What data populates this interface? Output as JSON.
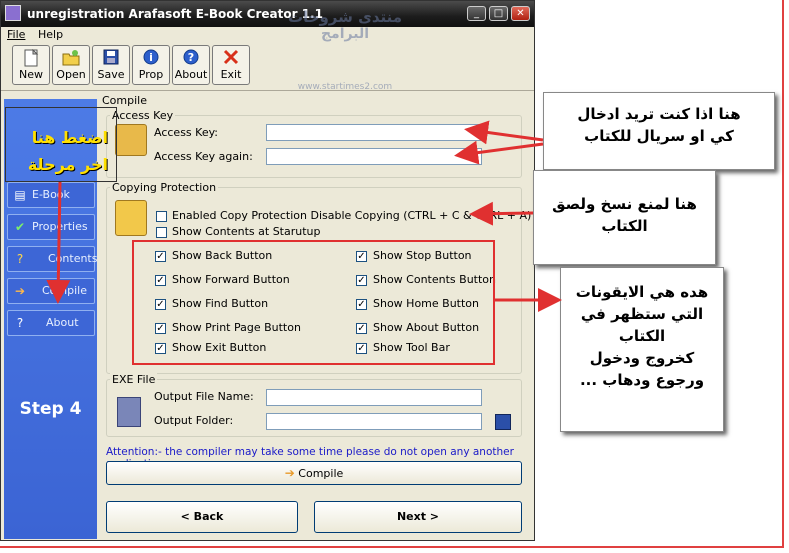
{
  "window": {
    "title": "unregistration Arafasoft E-Book Creator 1.1",
    "buttons": {
      "minimize": "_",
      "maximize": "□",
      "close": "✕"
    }
  },
  "menu": [
    "File",
    "Help"
  ],
  "toolbar": [
    {
      "label": "New",
      "icon": "new-document-icon"
    },
    {
      "label": "Open",
      "icon": "open-folder-icon"
    },
    {
      "label": "Save",
      "icon": "save-icon"
    },
    {
      "label": "Prop",
      "icon": "info-icon"
    },
    {
      "label": "About",
      "icon": "help-icon"
    },
    {
      "label": "Exit",
      "icon": "exit-icon"
    }
  ],
  "watermark": {
    "line1": "منتدى شروحات",
    "line2": "البرامج",
    "url": "www.startimes2.com"
  },
  "sidebar": {
    "items": [
      {
        "label": "E-Book Files",
        "icon": "files-icon"
      },
      {
        "label": "Properties",
        "icon": "check-icon"
      },
      {
        "label": "Contents",
        "icon": "question-icon"
      },
      {
        "label": "Compile",
        "icon": "arrow-right-icon"
      },
      {
        "label": "About",
        "icon": "help-icon"
      }
    ],
    "step": "Step 4"
  },
  "compile": {
    "section_title": "Compile",
    "access_key": {
      "group_title": "Access Key",
      "label1": "Access Key:",
      "label2": "Access Key again:",
      "value1": "",
      "value2": ""
    },
    "copying_protection": {
      "group_title": "Copying Protection",
      "enabled": {
        "label": "Enabled Copy Protection  Disable Copying (CTRL + C  &  CTRL + A)",
        "checked": false
      },
      "show_contents": {
        "label": "Show  Contents at Starutup",
        "checked": false
      },
      "options": [
        {
          "label": "Show Back Button",
          "checked": true
        },
        {
          "label": "Show Stop Button",
          "checked": true
        },
        {
          "label": "Show Forward Button",
          "checked": true
        },
        {
          "label": "Show  Contents Button",
          "checked": true
        },
        {
          "label": "Show Find Button",
          "checked": true
        },
        {
          "label": "Show Home Button",
          "checked": true
        },
        {
          "label": "Show Print Page Button",
          "checked": true
        },
        {
          "label": "Show About Button",
          "checked": true
        },
        {
          "label": "Show Exit  Button",
          "checked": true
        },
        {
          "label": "Show Tool Bar",
          "checked": true
        }
      ]
    },
    "exe_file": {
      "group_title": "EXE File",
      "output_name_label": "Output File Name:",
      "output_folder_label": "Output Folder:",
      "output_name_value": "",
      "output_folder_value": ""
    },
    "attention": "Attention:- the compiler may take some time please do not open any another application.",
    "compile_button": "Compile"
  },
  "nav": {
    "back": "< Back",
    "next": "Next >"
  },
  "annotations": {
    "sidebar_note": [
      "اضغط هنا",
      "اخر مرحلة"
    ],
    "access_key_note": [
      "هنا اذا كنت تريد ادخال",
      "كي او سريال للكتاب"
    ],
    "copy_note": [
      "هنا لمنع نسخ ولصق",
      "الكتاب"
    ],
    "icons_note": [
      "هده هي الايقونات",
      "التي ستظهر في",
      "الكتاب",
      "كخروج ودخول",
      "ورجوع ودهاب ..."
    ]
  },
  "colors": {
    "accent_red": "#e03030",
    "sidebar_blue": "#3b64d4",
    "title_dark": "#1c1c1c",
    "note_yellow": "#ffe000"
  }
}
